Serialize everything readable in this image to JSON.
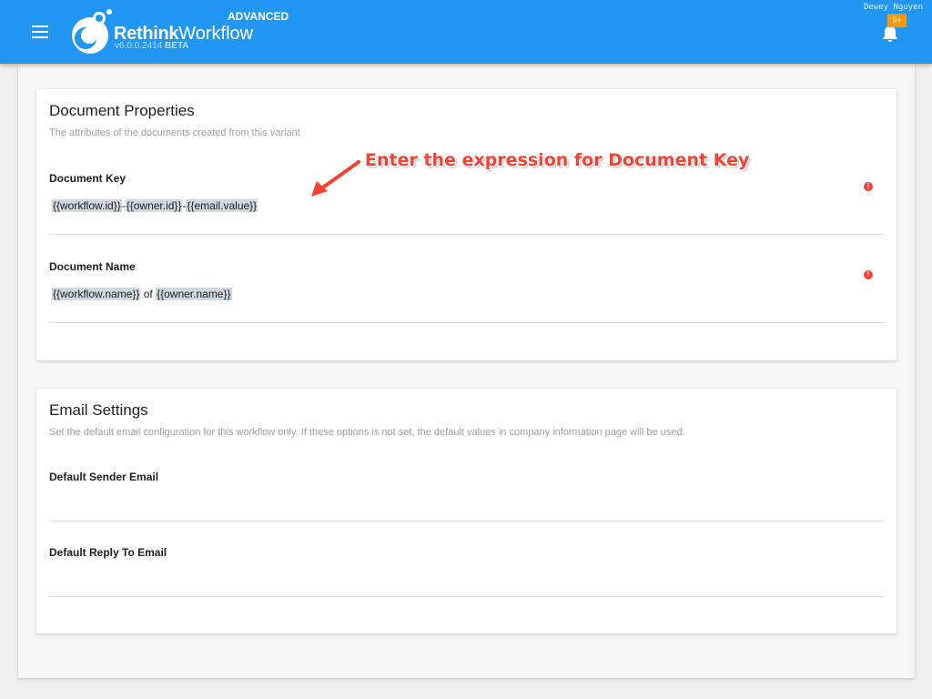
{
  "header": {
    "brand_bold": "Rethink",
    "brand_rest": "Workflow",
    "version": "v6.0.0.2414",
    "beta": "BETA",
    "edition": "ADVANCED",
    "user_name": "Dewey Nguyen",
    "notification_badge": "9+",
    "icons": {
      "menu": "menu-icon",
      "logo": "logo-icon",
      "bell": "bell-icon"
    }
  },
  "colors": {
    "primary": "#2196f3",
    "badge": "#ff9800",
    "error": "#f44336",
    "annotation": "#f44336"
  },
  "document_properties": {
    "title": "Document Properties",
    "subtitle": "The attributes of the documents created from this variant",
    "fields": [
      {
        "label": "Document Key",
        "tokens": [
          "{{workflow.id}}",
          "-",
          "{{owner.id}}",
          "-",
          "{{email.value}}"
        ]
      },
      {
        "label": "Document Name",
        "tokens": [
          "{{workflow.name}}",
          " of ",
          "{{owner.name}}"
        ]
      }
    ],
    "error_icon": "!"
  },
  "email_settings": {
    "title": "Email Settings",
    "subtitle": "Set the default email configuration for this workflow only. If these options is not set, the default values in company information page will be used.",
    "fields": [
      {
        "label": "Default Sender Email",
        "value": ""
      },
      {
        "label": "Default Reply To Email",
        "value": ""
      }
    ]
  },
  "annotation": {
    "text": "Enter the expression for Document Key"
  }
}
